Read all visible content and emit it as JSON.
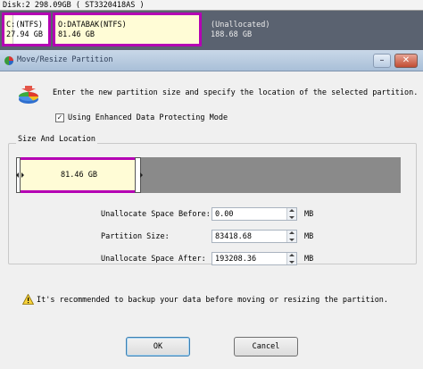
{
  "disk_map": {
    "header": "Disk:2 298.09GB  ( ST3320418AS )",
    "partitions": [
      {
        "name": "C:(NTFS)",
        "size": "27.94 GB"
      },
      {
        "name": "O:DATABAK(NTFS)",
        "size": "81.46 GB"
      },
      {
        "name": "(Unallocated)",
        "size": "188.68 GB"
      }
    ]
  },
  "window": {
    "title": "Move/Resize Partition",
    "minimize": "–",
    "close": "✕"
  },
  "dialog": {
    "intro": "Enter the new partition size and specify the location of the selected partition.",
    "checkbox_label": "Using Enhanced Data Protecting Mode",
    "checkbox_mark": "✓",
    "group_title": "Size And Location",
    "bar_label": "81.46 GB",
    "fields": [
      {
        "label": "Unallocate Space Before:",
        "value": "0.00",
        "unit": "MB"
      },
      {
        "label": "Partition Size:",
        "value": "83418.68",
        "unit": "MB"
      },
      {
        "label": "Unallocate Space After:",
        "value": "193208.36",
        "unit": "MB"
      }
    ],
    "warning": "It's recommended to backup your data before moving or resizing the partition.",
    "ok_label": "OK",
    "cancel_label": "Cancel"
  },
  "colors": {
    "selection_border": "#b400b4",
    "partition_fill": "#fffcd6",
    "unallocated": "#8a8a8a"
  }
}
